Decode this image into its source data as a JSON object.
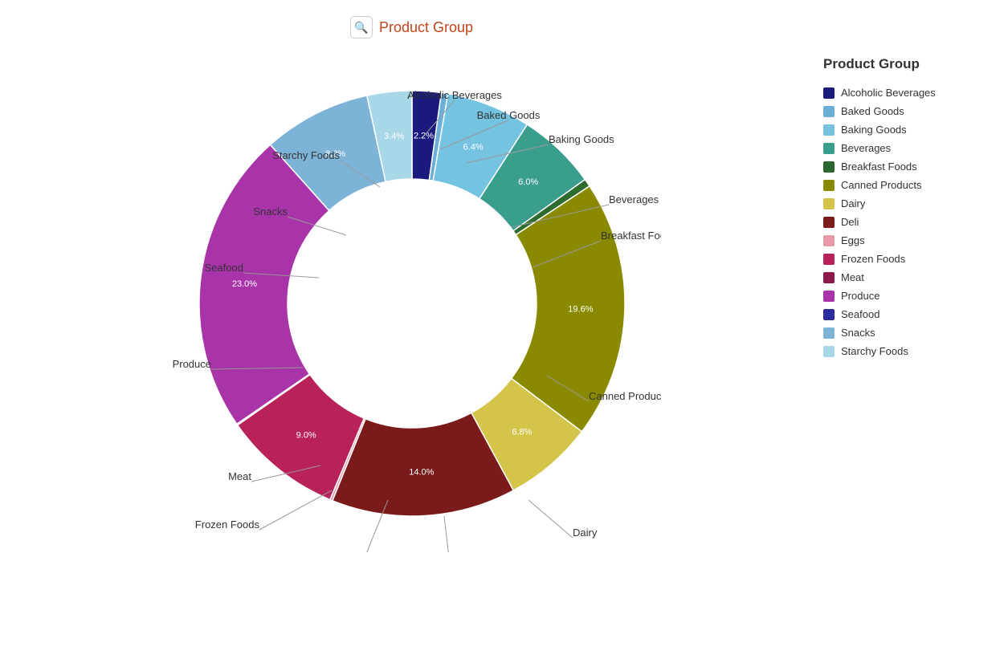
{
  "header": {
    "title": "Product Group",
    "icon": "🔍"
  },
  "legend": {
    "title": "Product Group",
    "items": [
      {
        "label": "Alcoholic Beverages",
        "color": "#1a1a7e"
      },
      {
        "label": "Baked Goods",
        "color": "#6baed6"
      },
      {
        "label": "Baking Goods",
        "color": "#74c3e0"
      },
      {
        "label": "Beverages",
        "color": "#3a9e8c"
      },
      {
        "label": "Breakfast Foods",
        "color": "#2e6b2e"
      },
      {
        "label": "Canned Products",
        "color": "#8a8a00"
      },
      {
        "label": "Dairy",
        "color": "#d4c44a"
      },
      {
        "label": "Deli",
        "color": "#7b1a1a"
      },
      {
        "label": "Eggs",
        "color": "#e899a8"
      },
      {
        "label": "Frozen Foods",
        "color": "#b8215a"
      },
      {
        "label": "Meat",
        "color": "#8b1a4a"
      },
      {
        "label": "Produce",
        "color": "#a933a9"
      },
      {
        "label": "Seafood",
        "color": "#2c2c9e"
      },
      {
        "label": "Snacks",
        "color": "#7eb3d8"
      },
      {
        "label": "Starchy Foods",
        "color": "#a8d8e8"
      }
    ]
  },
  "chart": {
    "segments": [
      {
        "label": "Alcoholic Beverages",
        "pct": 2.2,
        "color": "#1a1a7e"
      },
      {
        "label": "Baked Goods",
        "pct": 0.5,
        "color": "#6baed6"
      },
      {
        "label": "Baking Goods",
        "pct": 6.4,
        "color": "#74c3e0"
      },
      {
        "label": "Beverages",
        "pct": 6.0,
        "color": "#3a9e8c"
      },
      {
        "label": "Breakfast Foods",
        "pct": 0.6,
        "color": "#2e6b2e"
      },
      {
        "label": "Canned Products",
        "pct": 19.6,
        "color": "#8a8a00"
      },
      {
        "label": "Dairy",
        "pct": 6.8,
        "color": "#d4c44a"
      },
      {
        "label": "Deli",
        "pct": 14.0,
        "color": "#7b1a1a"
      },
      {
        "label": "Eggs",
        "pct": 0.2,
        "color": "#e899a8"
      },
      {
        "label": "Frozen Foods",
        "pct": 9.0,
        "color": "#b8215a"
      },
      {
        "label": "Meat",
        "pct": 0.1,
        "color": "#8b1a4a"
      },
      {
        "label": "Produce",
        "pct": 23.0,
        "color": "#a933a9"
      },
      {
        "label": "Seafood",
        "pct": 0.0,
        "color": "#2c2c9e"
      },
      {
        "label": "Snacks",
        "pct": 8.2,
        "color": "#7eb3d8"
      },
      {
        "label": "Starchy Foods",
        "pct": 3.4,
        "color": "#a8d8e8"
      }
    ]
  }
}
